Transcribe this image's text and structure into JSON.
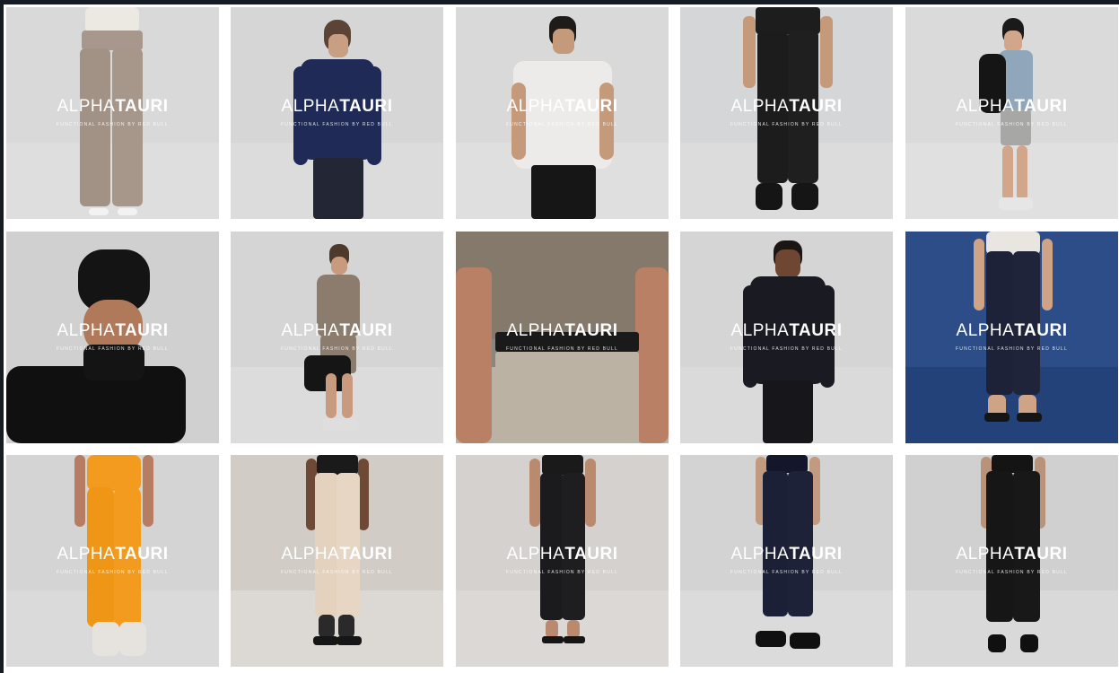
{
  "brand": {
    "logo_light": "ALPHA",
    "logo_bold": "TAURI",
    "tagline": "FUNCTIONAL FASHION BY RED BULL"
  },
  "tiles": [
    {
      "name": "tile-women-taupe-wide-trousers",
      "bg": "#d9d9d9",
      "floor": "#dedede"
    },
    {
      "name": "tile-men-navy-bomber-jacket",
      "bg": "#d6d6d7",
      "floor": "#dcdcdc"
    },
    {
      "name": "tile-men-white-tshirt",
      "bg": "#d9d9d9",
      "floor": "#dfdfdf"
    },
    {
      "name": "tile-men-black-cropped-trousers",
      "bg": "#d5d6d7",
      "floor": "#dcdcdc"
    },
    {
      "name": "tile-men-blue-shirt-backpack",
      "bg": "#dadada",
      "floor": "#e0e0e0"
    },
    {
      "name": "tile-women-black-beanie-knit",
      "bg": "#d0d0d0",
      "floor": "#d0d0d0"
    },
    {
      "name": "tile-men-taupe-tee-weekender-bag",
      "bg": "#d5d5d5",
      "floor": "#dcdcdc"
    },
    {
      "name": "tile-closeup-belt-beige-trousers",
      "bg": "#8a8580",
      "floor": "#b9b2a8"
    },
    {
      "name": "tile-men-black-zip-jacket",
      "bg": "#d5d5d5",
      "floor": "#dadada"
    },
    {
      "name": "tile-women-navy-trousers-blue-backdrop",
      "bg": "#2c4d87",
      "floor": "#23427a"
    },
    {
      "name": "tile-women-orange-trousers",
      "bg": "#d4d4d4",
      "floor": "#dadada"
    },
    {
      "name": "tile-women-beige-trousers",
      "bg": "#d1ccc6",
      "floor": "#dcd8d3"
    },
    {
      "name": "tile-women-black-trousers-sandals",
      "bg": "#d4d1ce",
      "floor": "#dbd8d5"
    },
    {
      "name": "tile-women-navy-pleated-trousers",
      "bg": "#d3d3d3",
      "floor": "#dbdbdb"
    },
    {
      "name": "tile-women-black-pleated-trousers",
      "bg": "#d0d0d0",
      "floor": "#d9d9d9"
    }
  ]
}
